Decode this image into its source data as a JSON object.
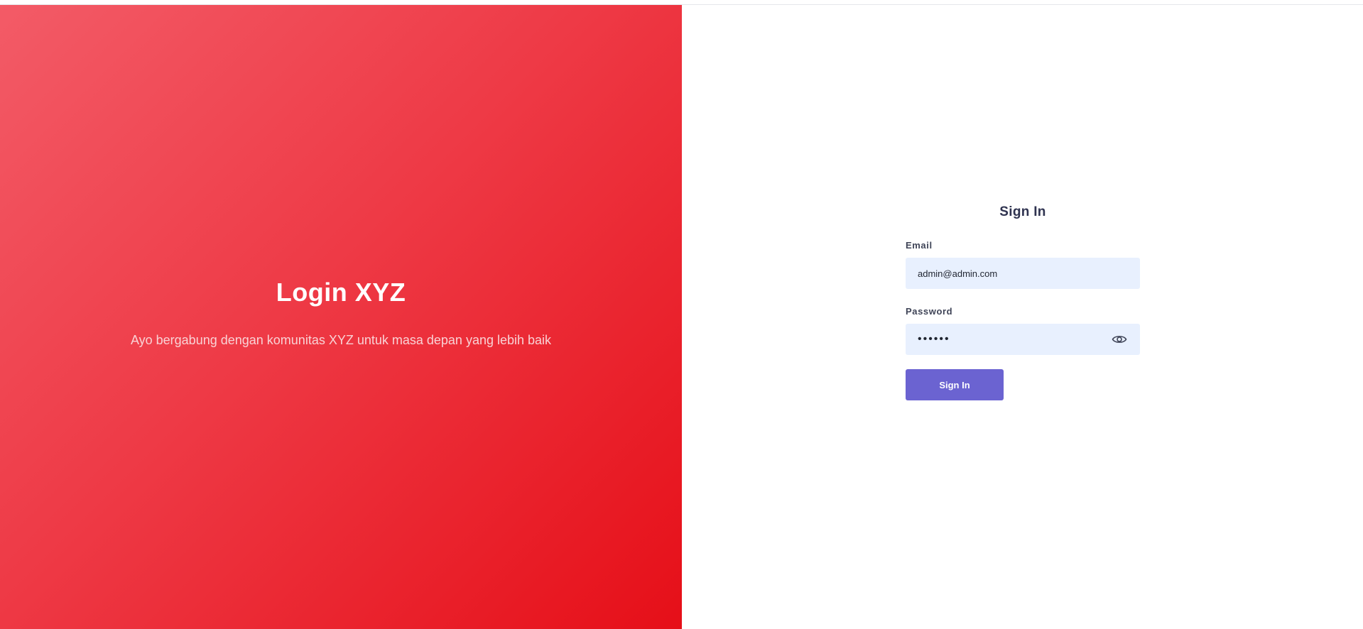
{
  "hero": {
    "title": "Login XYZ",
    "subtitle": "Ayo bergabung dengan komunitas XYZ untuk masa depan yang lebih baik",
    "gradient_start": "#f35b67",
    "gradient_end": "#e60f18"
  },
  "form": {
    "title": "Sign In",
    "email": {
      "label": "Email",
      "value": "admin@admin.com"
    },
    "password": {
      "label": "Password",
      "value": "••••••",
      "toggle_icon": "eye-icon"
    },
    "submit_label": "Sign In",
    "accent_color": "#6b63d1",
    "input_bg": "#e8f0fe"
  }
}
